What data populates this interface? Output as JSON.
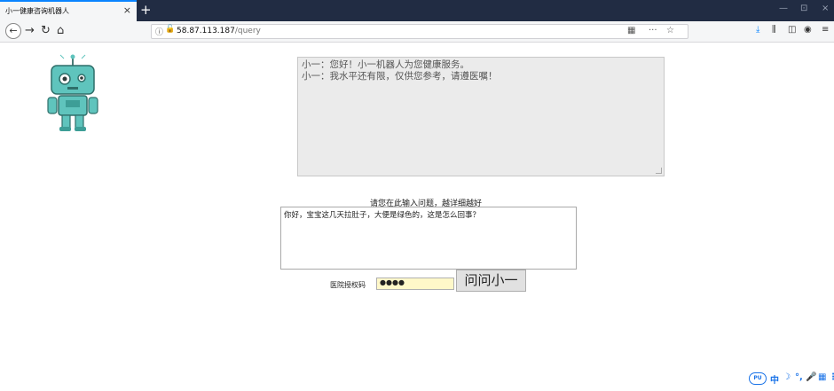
{
  "browser": {
    "tab_title": "小一健康咨询机器人",
    "tab_close": "×",
    "new_tab": "+",
    "window_controls": [
      "—",
      "⊡",
      "×"
    ],
    "nav": {
      "back": "←",
      "forward": "→",
      "reload": "↻",
      "home": "⌂"
    },
    "url": {
      "host": "58.87.113.187",
      "path": "/query"
    },
    "toolbar_icons": [
      "download-icon",
      "library-icon",
      "sidebar-icon",
      "account-icon",
      "menu-icon"
    ]
  },
  "chat": {
    "lines": [
      "小一：您好！小一机器人为您健康服务。",
      "小一：我水平还有限，仅供您参考，请遵医嘱！"
    ]
  },
  "form": {
    "prompt": "请您在此输入问题，越详细越好",
    "question_value": "你好，宝宝这几天拉肚子，大便是绿色的，这是怎么回事？",
    "auth_label": "医院授权码",
    "auth_value": "●●●●",
    "ask_button": "问问小一"
  },
  "ime": {
    "logo": "PU",
    "items": [
      "中",
      "☽",
      "°,",
      "🎤",
      "▦",
      "⋮"
    ]
  },
  "colors": {
    "tabstrip": "#212c43",
    "accent": "#0a84ff",
    "chat_bg": "#ebebeb",
    "robot_teal": "#5fc4bd",
    "auth_bg": "#fff8c9"
  }
}
